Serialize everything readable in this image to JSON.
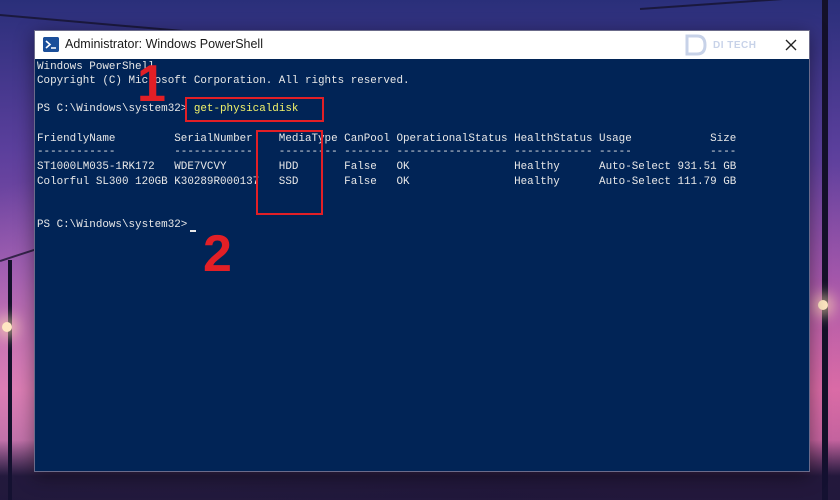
{
  "window": {
    "title": "Administrator: Windows PowerShell",
    "app_icon": "powershell-icon",
    "close_icon": "close-icon",
    "watermark_text": "DI TECH"
  },
  "console": {
    "banner_1": "Windows PowerShell",
    "banner_2": "Copyright (C) Microsoft Corporation. All rights reserved.",
    "prompt_1": "PS C:\\Windows\\system32> ",
    "command": "get-physicaldisk",
    "table": {
      "header": "FriendlyName         SerialNumber    MediaType CanPool OperationalStatus HealthStatus Usage            Size",
      "separator": "------------         ------------    --------- ------- ----------------- ------------ -----            ----",
      "rows": [
        "ST1000LM035-1RK172   WDE7VCVY        HDD       False   OK                Healthy      Auto-Select 931.51 GB",
        "Colorful SL300 120GB K30289R000137   SSD       False   OK                Healthy      Auto-Select 111.79 GB"
      ]
    },
    "prompt_2": "PS C:\\Windows\\system32> "
  },
  "annotations": {
    "step_1": "1",
    "step_2": "2",
    "color": "#e21f26"
  },
  "colors": {
    "console_bg": "#012456",
    "console_text": "#e8e8e8",
    "command_text": "#f4f46a",
    "titlebar_bg": "#ffffff"
  }
}
